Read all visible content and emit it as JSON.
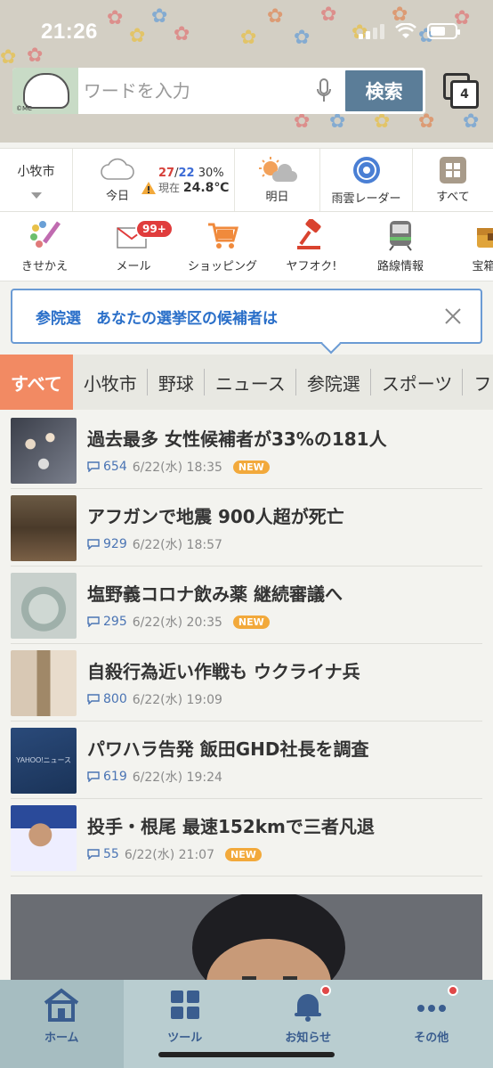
{
  "status": {
    "time": "21:26"
  },
  "search": {
    "placeholder": "ワードを入力",
    "button": "検索",
    "tab_count": "4",
    "logo_mark": "©MC"
  },
  "weather": {
    "city": "小牧市",
    "today_label": "今日",
    "high": "27",
    "low": "22",
    "precip": "30%",
    "current_prefix": "現在",
    "current_temp": "24.8℃",
    "tomorrow_label": "明日",
    "radar_label": "雨雲レーダー",
    "all_label": "すべて"
  },
  "services": [
    {
      "label": "きせかえ",
      "icon": "paint-brush-icon"
    },
    {
      "label": "メール",
      "icon": "mail-icon",
      "badge": "99+"
    },
    {
      "label": "ショッピング",
      "icon": "cart-icon"
    },
    {
      "label": "ヤフオク!",
      "icon": "auction-hammer-icon"
    },
    {
      "label": "路線情報",
      "icon": "train-icon"
    },
    {
      "label": "宝箱く",
      "icon": "treasure-icon"
    }
  ],
  "notice": {
    "text": "参院選　あなたの選挙区の候補者は"
  },
  "categories": [
    "すべて",
    "小牧市",
    "野球",
    "ニュース",
    "参院選",
    "スポーツ",
    "フォ"
  ],
  "news": [
    {
      "title": "過去最多 女性候補者が33%の181人",
      "comments": "654",
      "date": "6/22(水) 18:35",
      "new": "NEW"
    },
    {
      "title": "アフガンで地震 900人超が死亡",
      "comments": "929",
      "date": "6/22(水) 18:57",
      "new": ""
    },
    {
      "title": "塩野義コロナ飲み薬 継続審議へ",
      "comments": "295",
      "date": "6/22(水) 20:35",
      "new": "NEW"
    },
    {
      "title": "自殺行為近い作戦も ウクライナ兵",
      "comments": "800",
      "date": "6/22(水) 19:09",
      "new": ""
    },
    {
      "title": "パワハラ告発 飯田GHD社長を調査",
      "comments": "619",
      "date": "6/22(水) 19:24",
      "new": ""
    },
    {
      "title": "投手・根尾 最速152kmで三者凡退",
      "comments": "55",
      "date": "6/22(水) 21:07",
      "new": "NEW"
    }
  ],
  "news_thumb_text": "YAHOO!ニュース",
  "bottom_nav": [
    {
      "label": "ホーム",
      "icon": "home-icon"
    },
    {
      "label": "ツール",
      "icon": "grid-icon"
    },
    {
      "label": "お知らせ",
      "icon": "bell-icon"
    },
    {
      "label": "その他",
      "icon": "more-icon"
    }
  ],
  "colors": {
    "accent": "#f28a63",
    "search_button": "#5b7d98",
    "link_blue": "#2a6fc9",
    "badge_red": "#e03c3c",
    "new_badge": "#f2a93b"
  }
}
